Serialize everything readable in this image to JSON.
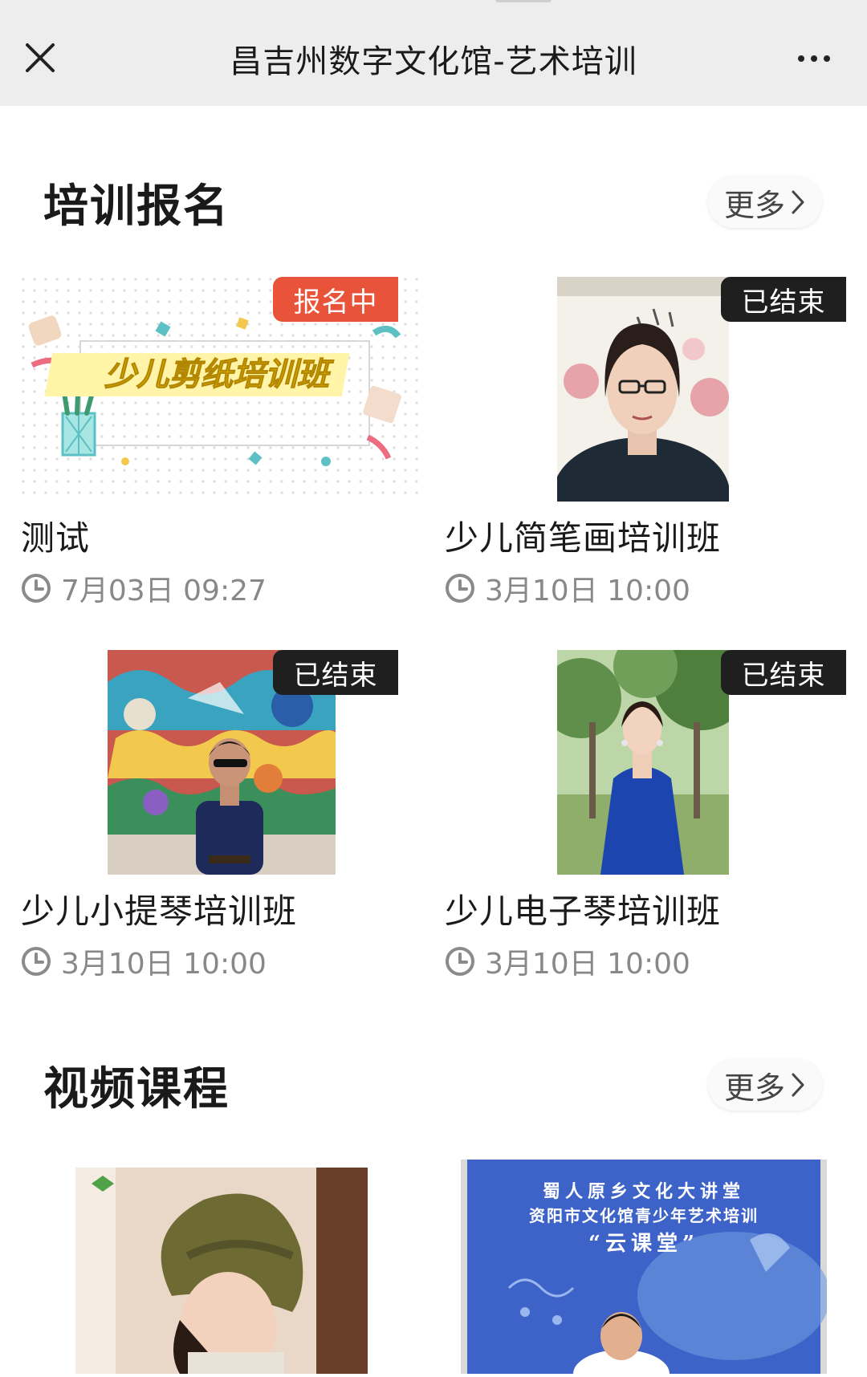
{
  "header": {
    "title": "昌吉州数字文化馆-艺术培训"
  },
  "training": {
    "title": "培训报名",
    "more_label": "更多",
    "cards": [
      {
        "badge": "报名中",
        "badge_color": "#e8533a",
        "name": "测试",
        "time": "7月03日 09:27",
        "banner_text": "少儿剪纸培训班"
      },
      {
        "badge": "已结束",
        "badge_color": "#1f1f1f",
        "name": "少儿简笔画培训班",
        "time": "3月10日 10:00"
      },
      {
        "badge": "已结束",
        "badge_color": "#1f1f1f",
        "name": "少儿小提琴培训班",
        "time": "3月10日 10:00"
      },
      {
        "badge": "已结束",
        "badge_color": "#1f1f1f",
        "name": "少儿电子琴培训班",
        "time": "3月10日 10:00"
      }
    ]
  },
  "video": {
    "title": "视频课程",
    "more_label": "更多",
    "courses": [
      {},
      {
        "line1": "蜀人原乡文化大讲堂",
        "line2": "资阳市文化馆青少年艺术培训",
        "line3": "“云课堂”"
      }
    ]
  },
  "icons": {
    "close": "close-icon",
    "more": "more-dots-icon",
    "chevron": "chevron-right-icon",
    "clock": "clock-icon"
  }
}
